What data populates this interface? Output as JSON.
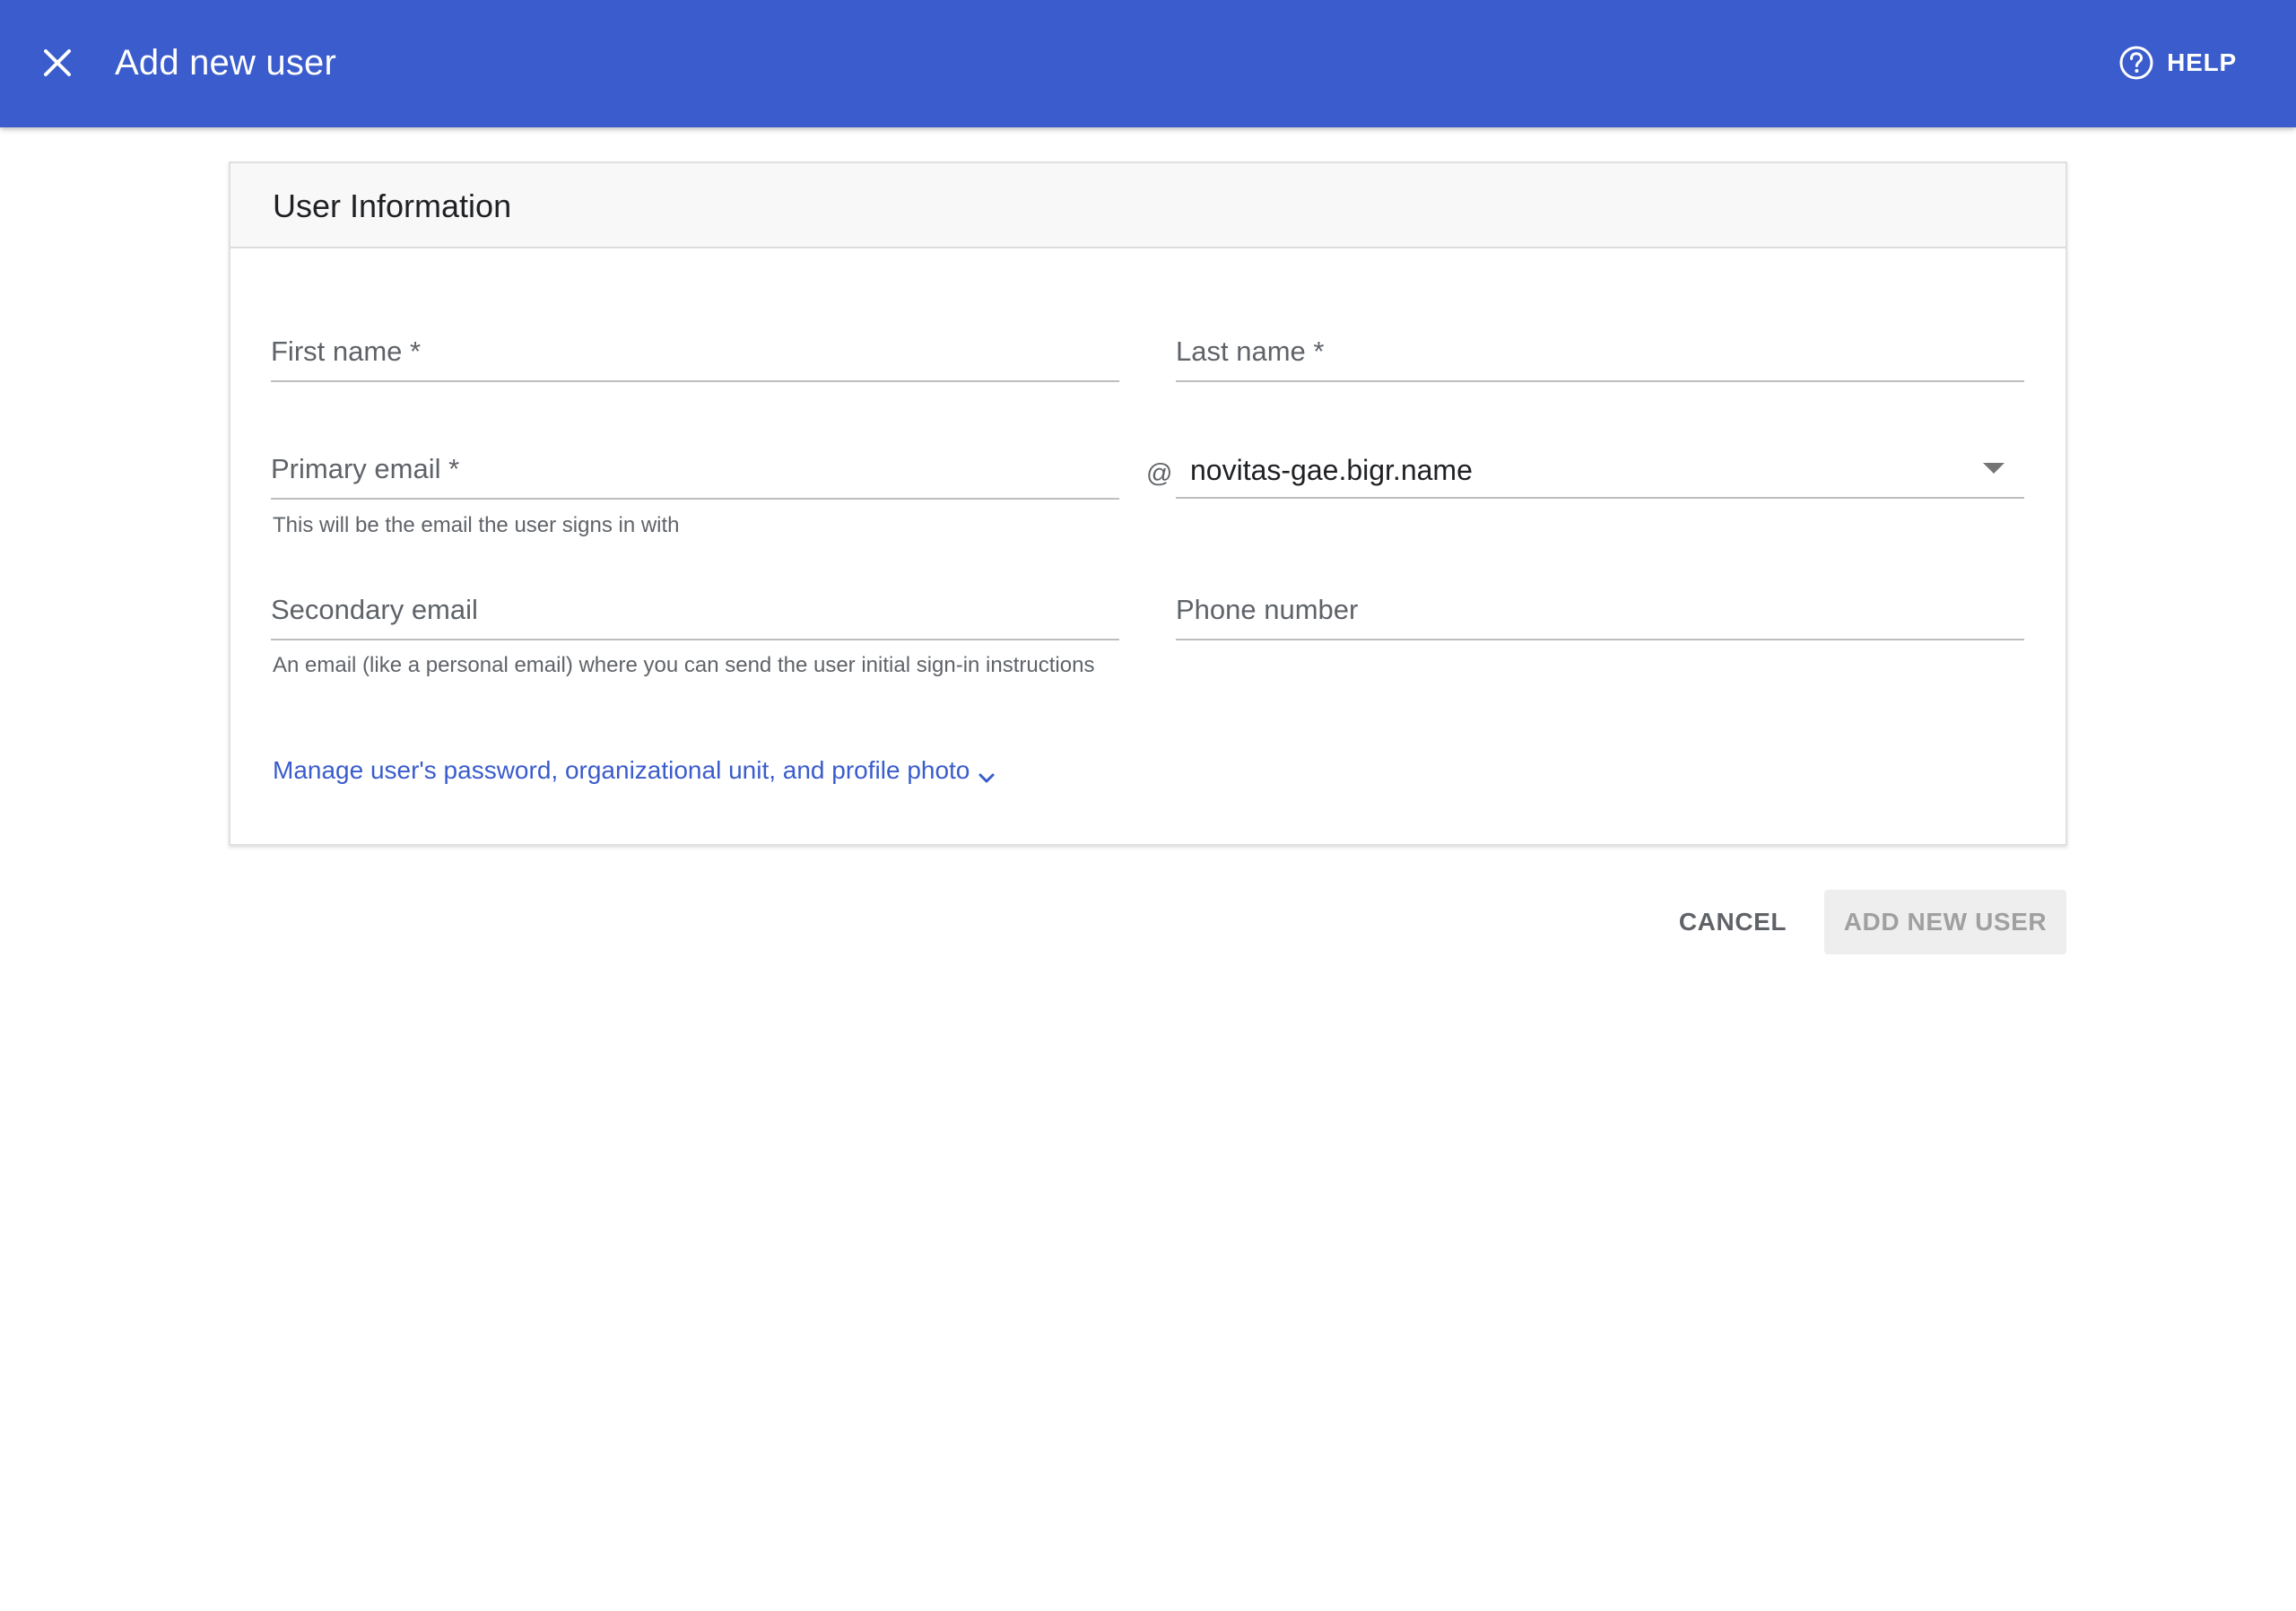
{
  "appbar": {
    "title": "Add new user",
    "close_icon": "close-icon",
    "help_icon": "help-circle-icon",
    "help_label": "HELP",
    "color": "#3a5ccc"
  },
  "card": {
    "title": "User Information",
    "fields": {
      "first_name": {
        "label": "First name *",
        "value": ""
      },
      "last_name": {
        "label": "Last name *",
        "value": ""
      },
      "primary_email": {
        "label": "Primary email *",
        "hint": "This will be the email the user signs in with",
        "value": ""
      },
      "at_sign": "@",
      "domain": {
        "value": "novitas-gae.bigr.name",
        "icon": "dropdown-arrow-icon"
      },
      "secondary_email": {
        "label": "Secondary email",
        "hint": "An email (like a personal email) where you can send the user initial sign-in instructions",
        "value": ""
      },
      "phone_number": {
        "label": "Phone number",
        "value": ""
      }
    },
    "manage_link": {
      "label": "Manage user's password, organizational unit, and profile photo",
      "icon": "chevron-down-icon"
    }
  },
  "actions": {
    "cancel_label": "CANCEL",
    "add_label": "ADD NEW USER",
    "add_enabled": false
  }
}
